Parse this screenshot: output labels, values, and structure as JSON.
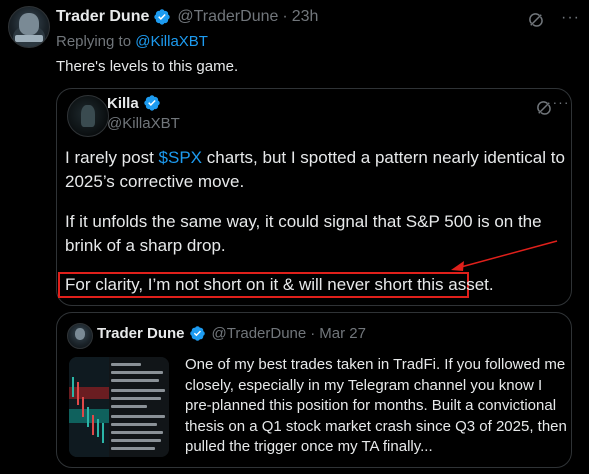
{
  "tweet": {
    "author_name": "Trader Dune",
    "author_handle": "@TraderDune",
    "time_sep": "·",
    "time": "23h",
    "replying_prefix": "Replying to",
    "replying_to": "@KillaXBT",
    "text": "There's levels to this game."
  },
  "quoted_tweet": {
    "author_name": "Killa",
    "author_handle": "@KillaXBT",
    "para1_pre": "I rarely post ",
    "para1_cashtag": "$SPX",
    "para1_post": " charts, but I spotted a pattern nearly identical to 2025’s corrective move.",
    "para2": "If it unfolds the same way, it could signal that S&P 500 is on the brink of a sharp drop.",
    "highlighted": "For clarity, I’m not short on it & will never short this asset."
  },
  "nested_quote": {
    "author_name": "Trader Dune",
    "author_handle": "@TraderDune",
    "time_sep": "·",
    "time": "Mar 27",
    "text": "One of my best trades taken in TradFi. If you followed me closely, especially in my Telegram channel you know I pre-planned this position for months. Built a convictional thesis on a Q1 stock market crash since Q3 of 2025, then pulled the trigger once my TA finally..."
  },
  "colors": {
    "background": "#000000",
    "text": "#e7e9ea",
    "muted": "#71767b",
    "link": "#1d9bf0",
    "border": "#2f3336",
    "annotation_red": "#e0201b"
  },
  "icons": {
    "verified": "verified-badge-icon",
    "grok": "grok-icon",
    "more": "more-options-icon"
  }
}
